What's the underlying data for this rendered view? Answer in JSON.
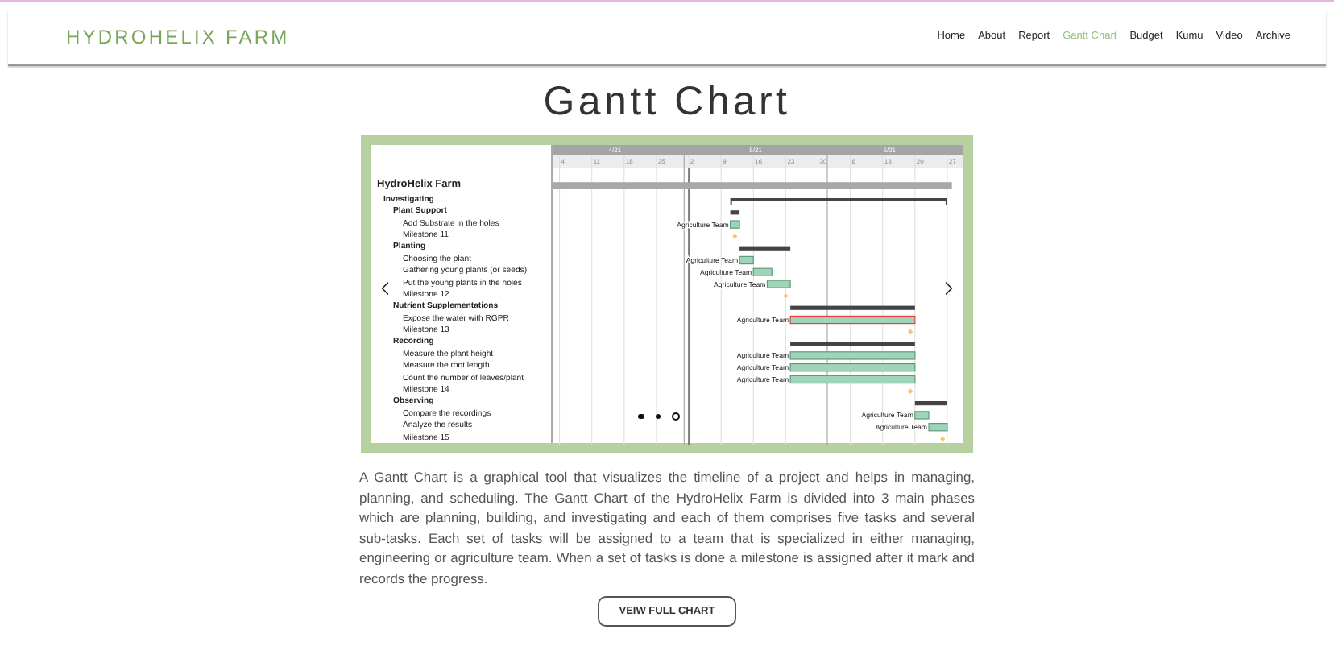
{
  "header": {
    "logo": "HYDROHELIX FARM",
    "nav": [
      {
        "label": "Home",
        "selected": false
      },
      {
        "label": "About",
        "selected": false
      },
      {
        "label": "Report",
        "selected": false
      },
      {
        "label": "Gantt Chart",
        "selected": true
      },
      {
        "label": "Budget",
        "selected": false
      },
      {
        "label": "Kumu",
        "selected": false
      },
      {
        "label": "Video",
        "selected": false
      },
      {
        "label": "Archive",
        "selected": false
      }
    ]
  },
  "title": "Gantt Chart",
  "gantt": {
    "months": [
      "4/21",
      "5/21",
      "6/21"
    ],
    "days": [
      "4",
      "11",
      "18",
      "25",
      "2",
      "9",
      "16",
      "23",
      "30",
      "6",
      "13",
      "20",
      "27"
    ],
    "rows": [
      {
        "kind": "project",
        "label": "HydroHelix Farm"
      },
      {
        "kind": "phase",
        "label": "Investigating"
      },
      {
        "kind": "group",
        "label": "Plant Support"
      },
      {
        "kind": "task",
        "label": "Add Substrate in the holes",
        "team": "Agriculture Team",
        "critical": false
      },
      {
        "kind": "milestone",
        "label": "Milestone 11"
      },
      {
        "kind": "group",
        "label": "Planting"
      },
      {
        "kind": "task",
        "label": "Choosing the plant",
        "team": "Agriculture Team",
        "critical": false
      },
      {
        "kind": "task",
        "label": "Gathering young plants (or seeds)",
        "team": "Agriculture Team",
        "critical": false
      },
      {
        "kind": "task",
        "label": "Put the young plants in the holes",
        "team": "Agriculture Team",
        "critical": false
      },
      {
        "kind": "milestone",
        "label": "Milestone 12"
      },
      {
        "kind": "group",
        "label": "Nutrient Supplementations"
      },
      {
        "kind": "task",
        "label": "Expose the water with RGPR",
        "team": "Agriculture Team",
        "critical": true
      },
      {
        "kind": "milestone",
        "label": "Milestone 13"
      },
      {
        "kind": "group",
        "label": "Recording"
      },
      {
        "kind": "task",
        "label": "Measure the plant height",
        "team": "Agriculture Team",
        "critical": false
      },
      {
        "kind": "task",
        "label": "Measure the root length",
        "team": "Agriculture Team",
        "critical": false
      },
      {
        "kind": "task",
        "label": "Count the number of leaves/plant",
        "team": "Agriculture Team",
        "critical": false
      },
      {
        "kind": "milestone",
        "label": "Milestone 14"
      },
      {
        "kind": "group",
        "label": "Observing"
      },
      {
        "kind": "task",
        "label": "Compare the recordings",
        "team": "Agriculture Team",
        "critical": false
      },
      {
        "kind": "task",
        "label": "Analyze the results",
        "team": "Agriculture Team",
        "critical": false
      },
      {
        "kind": "milestone",
        "label": "Milestone 15"
      }
    ],
    "slides": [
      {
        "selected": false
      },
      {
        "selected": false
      },
      {
        "selected": true
      }
    ]
  },
  "description": "A Gantt Chart is a graphical tool that visualizes the timeline of a project and helps in managing, planning, and scheduling. The Gantt Chart of the HydroHelix Farm is divided into 3 main phases which are planning, building, and investigating and each of them comprises five tasks and several sub-tasks. Each set of tasks will be assigned to a team that is specialized in either managing, engineering or agriculture team. When a set of tasks is done a milestone is assigned after it mark and records the progress.",
  "button": "VEIW FULL CHART"
}
